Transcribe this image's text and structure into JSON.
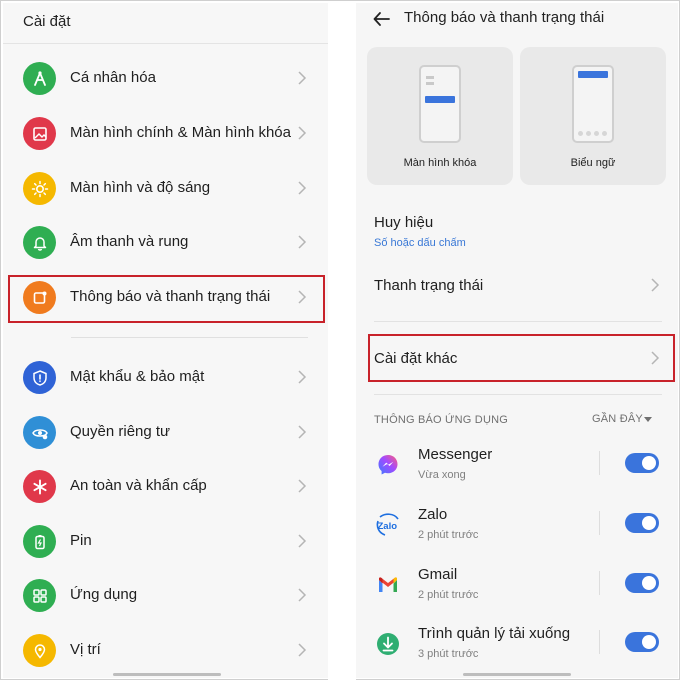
{
  "colors": {
    "accent": "#3a74dc",
    "highlight_border": "#c8222a"
  },
  "left_panel": {
    "title": "Cài đặt",
    "items": [
      {
        "label": "Cá nhân hóa",
        "icon": "personalization-icon",
        "color": "#2fae52"
      },
      {
        "label": "Màn hình chính & Màn hình khóa",
        "icon": "wallpaper-icon",
        "color": "#e0384a"
      },
      {
        "label": "Màn hình và độ sáng",
        "icon": "brightness-icon",
        "color": "#f5b800"
      },
      {
        "label": "Âm thanh và rung",
        "icon": "bell-icon",
        "color": "#2fae52"
      },
      {
        "label": "Thông báo và thanh trạng thái",
        "icon": "notification-icon",
        "color": "#f07b1e"
      },
      {
        "label": "Mật khẩu & bảo mật",
        "icon": "shield-icon",
        "color": "#2f63d6"
      },
      {
        "label": "Quyền riêng tư",
        "icon": "privacy-eye-icon",
        "color": "#2f8fd6"
      },
      {
        "label": "An toàn và khẩn cấp",
        "icon": "emergency-icon",
        "color": "#e0384a"
      },
      {
        "label": "Pin",
        "icon": "battery-icon",
        "color": "#2fae52"
      },
      {
        "label": "Ứng dụng",
        "icon": "apps-grid-icon",
        "color": "#2fae52"
      },
      {
        "label": "Vị trí",
        "icon": "location-icon",
        "color": "#f5b800"
      }
    ]
  },
  "right_panel": {
    "title": "Thông báo và thanh trạng thái",
    "cards": [
      {
        "label": "Màn hình khóa"
      },
      {
        "label": "Biểu ngữ"
      }
    ],
    "huy_hieu": {
      "label": "Huy hiệu",
      "sub": "Số hoặc dấu chấm"
    },
    "thanh_trang_thai": "Thanh trạng thái",
    "cai_dat_khac": "Cài đặt khác",
    "section_title": "THÔNG BÁO ỨNG DỤNG",
    "sort_label": "GẦN ĐÂY",
    "apps": [
      {
        "name": "Messenger",
        "time": "Vừa xong",
        "icon": "messenger-icon",
        "enabled": true
      },
      {
        "name": "Zalo",
        "time": "2 phút trước",
        "icon": "zalo-icon",
        "icon_text": "Zalo",
        "enabled": true
      },
      {
        "name": "Gmail",
        "time": "2 phút trước",
        "icon": "gmail-icon",
        "enabled": true
      },
      {
        "name": "Trình quản lý tải xuống",
        "time": "3 phút trước",
        "icon": "download-icon",
        "enabled": true
      }
    ]
  }
}
